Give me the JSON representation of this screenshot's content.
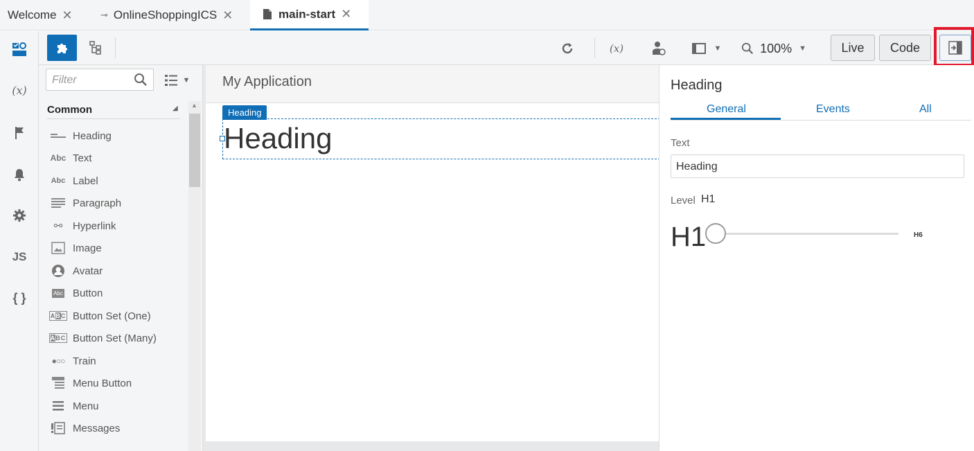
{
  "tabs": [
    {
      "label": "Welcome"
    },
    {
      "label": "OnlineShoppingICS"
    },
    {
      "label": "main-start"
    }
  ],
  "toolbar": {
    "zoom": "100%",
    "live_label": "Live",
    "code_label": "Code"
  },
  "rail": {
    "variables": "(x)",
    "js": "JS",
    "json": "{ }"
  },
  "palette": {
    "filter_placeholder": "Filter",
    "section": "Common",
    "items": [
      {
        "label": "Heading",
        "icon": "heading-icon"
      },
      {
        "label": "Text",
        "icon": "text-icon"
      },
      {
        "label": "Label",
        "icon": "label-icon"
      },
      {
        "label": "Paragraph",
        "icon": "paragraph-icon"
      },
      {
        "label": "Hyperlink",
        "icon": "hyperlink-icon"
      },
      {
        "label": "Image",
        "icon": "image-icon"
      },
      {
        "label": "Avatar",
        "icon": "avatar-icon"
      },
      {
        "label": "Button",
        "icon": "button-icon"
      },
      {
        "label": "Button Set (One)",
        "icon": "button-set-one-icon"
      },
      {
        "label": "Button Set (Many)",
        "icon": "button-set-many-icon"
      },
      {
        "label": "Train",
        "icon": "train-icon"
      },
      {
        "label": "Menu Button",
        "icon": "menu-button-icon"
      },
      {
        "label": "Menu",
        "icon": "menu-icon"
      },
      {
        "label": "Messages",
        "icon": "messages-icon"
      }
    ]
  },
  "canvas": {
    "app_title": "My Application",
    "selected_tag": "Heading",
    "heading_text": "Heading"
  },
  "properties": {
    "title": "Heading",
    "tabs": [
      "General",
      "Events",
      "All"
    ],
    "text_label": "Text",
    "text_value": "Heading",
    "level_label": "Level",
    "level_value": "H1",
    "slider_min": "H1",
    "slider_max": "H6",
    "level_fraction": 0
  },
  "colors": {
    "accent": "#0f6eb5",
    "highlight": "#e2192c"
  }
}
